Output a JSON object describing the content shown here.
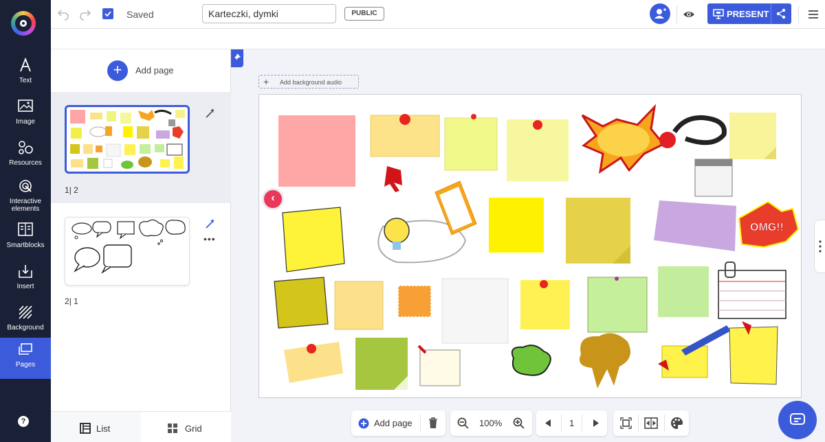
{
  "nav": {
    "items": [
      {
        "label": "Text"
      },
      {
        "label": "Image"
      },
      {
        "label": "Resources"
      },
      {
        "label": "Interactive elements"
      },
      {
        "label": "Smartblocks"
      },
      {
        "label": "Insert"
      },
      {
        "label": "Background"
      },
      {
        "label": "Pages"
      }
    ],
    "help": "?"
  },
  "topbar": {
    "saved": "Saved",
    "title_value": "Karteczki, dymki",
    "public_label": "PUBLIC",
    "present_label": "PRESENT"
  },
  "pages_panel": {
    "add_page": "Add page",
    "pages": [
      {
        "number": "1",
        "count": "2"
      },
      {
        "number": "2",
        "count": "1"
      }
    ],
    "tabs": {
      "list": "List",
      "grid": "Grid"
    }
  },
  "canvas": {
    "add_audio": "Add background audio",
    "omg_text": "OMG!!"
  },
  "bottom_toolbar": {
    "add_page": "Add page",
    "zoom": "100%",
    "page": "1"
  },
  "colors": {
    "accent": "#3b5bdb",
    "nav_bg": "#1a2035",
    "back_button": "#e9385a"
  }
}
